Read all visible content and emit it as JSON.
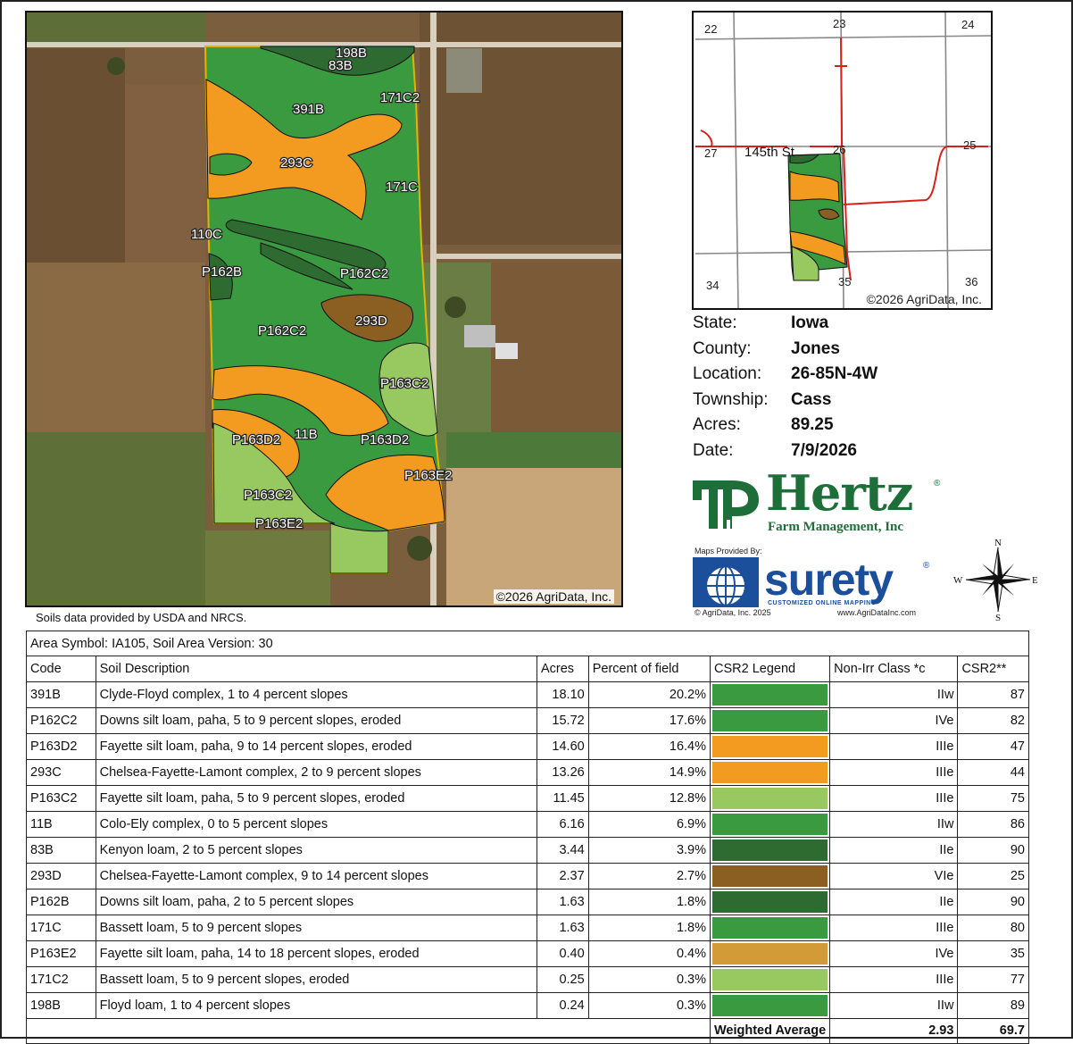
{
  "aerial_map": {
    "copyright": "©2026 AgriData, Inc.",
    "soil_labels": [
      "198B",
      "83B",
      "171C2",
      "391B",
      "293C",
      "171C",
      "110C",
      "P162B",
      "P162C2",
      "293D",
      "P162C2",
      "P163C2",
      "P163D2",
      "11B",
      "P163D2",
      "P163E2",
      "P163C2",
      "P163E2"
    ],
    "colors": {
      "dark_green": "#2e6b30",
      "green": "#3a9a40",
      "orange": "#f39a20",
      "light_green": "#98c860",
      "brown": "#8b5e22"
    }
  },
  "source_note": "Soils data provided by USDA and NRCS.",
  "locator_map": {
    "section_numbers": [
      "22",
      "23",
      "24",
      "27",
      "26",
      "25",
      "34",
      "35",
      "36"
    ],
    "road_label": "145th St",
    "copyright": "©2026 AgriData, Inc."
  },
  "info": {
    "state_label": "State:",
    "state": "Iowa",
    "county_label": "County:",
    "county": "Jones",
    "location_label": "Location:",
    "location": "26-85N-4W",
    "township_label": "Township:",
    "township": "Cass",
    "acres_label": "Acres:",
    "acres": "89.25",
    "date_label": "Date:",
    "date": "7/9/2026"
  },
  "hertz_logo": {
    "name": "Hertz",
    "registered": "®",
    "subtitle": "Farm Management, Inc",
    "color": "#1e6e3a"
  },
  "surety_logo": {
    "maps_by": "Maps Provided By:",
    "name": "surety",
    "registered": "®",
    "tagline": "CUSTOMIZED ONLINE MAPPING",
    "copyright": "© AgriData, Inc. 2025",
    "url": "www.AgriDataInc.com",
    "color": "#1b4e9b"
  },
  "compass": {
    "north": "N",
    "south": "S",
    "east": "E",
    "west": "W"
  },
  "table": {
    "area_line": "Area Symbol: IA105, Soil Area Version: 30",
    "headers": {
      "code": "Code",
      "description": "Soil Description",
      "acres": "Acres",
      "percent": "Percent of field",
      "legend": "CSR2 Legend",
      "class": "Non-Irr Class *c",
      "csr2": "CSR2**"
    },
    "rows": [
      {
        "code": "391B",
        "description": "Clyde-Floyd complex, 1 to 4 percent slopes",
        "acres": "18.10",
        "percent": "20.2%",
        "color": "#3a9a40",
        "class": "IIw",
        "csr2": "87"
      },
      {
        "code": "P162C2",
        "description": "Downs silt loam, paha, 5 to 9 percent slopes, eroded",
        "acres": "15.72",
        "percent": "17.6%",
        "color": "#3a9a40",
        "class": "IVe",
        "csr2": "82"
      },
      {
        "code": "P163D2",
        "description": "Fayette silt loam, paha, 9 to 14 percent slopes, eroded",
        "acres": "14.60",
        "percent": "16.4%",
        "color": "#f39a20",
        "class": "IIIe",
        "csr2": "47"
      },
      {
        "code": "293C",
        "description": "Chelsea-Fayette-Lamont complex, 2 to 9 percent slopes",
        "acres": "13.26",
        "percent": "14.9%",
        "color": "#f39a20",
        "class": "IIIe",
        "csr2": "44"
      },
      {
        "code": "P163C2",
        "description": "Fayette silt loam, paha, 5 to 9 percent slopes, eroded",
        "acres": "11.45",
        "percent": "12.8%",
        "color": "#98c860",
        "class": "IIIe",
        "csr2": "75"
      },
      {
        "code": "11B",
        "description": "Colo-Ely complex, 0 to 5 percent slopes",
        "acres": "6.16",
        "percent": "6.9%",
        "color": "#3a9a40",
        "class": "IIw",
        "csr2": "86"
      },
      {
        "code": "83B",
        "description": "Kenyon loam, 2 to 5 percent slopes",
        "acres": "3.44",
        "percent": "3.9%",
        "color": "#2e6b30",
        "class": "IIe",
        "csr2": "90"
      },
      {
        "code": "293D",
        "description": "Chelsea-Fayette-Lamont complex, 9 to 14 percent slopes",
        "acres": "2.37",
        "percent": "2.7%",
        "color": "#8b5e22",
        "class": "VIe",
        "csr2": "25"
      },
      {
        "code": "P162B",
        "description": "Downs silt loam, paha, 2 to 5 percent slopes",
        "acres": "1.63",
        "percent": "1.8%",
        "color": "#2e6b30",
        "class": "IIe",
        "csr2": "90"
      },
      {
        "code": "171C",
        "description": "Bassett loam, 5 to 9 percent slopes",
        "acres": "1.63",
        "percent": "1.8%",
        "color": "#3a9a40",
        "class": "IIIe",
        "csr2": "80"
      },
      {
        "code": "P163E2",
        "description": "Fayette silt loam, paha, 14 to 18 percent slopes, eroded",
        "acres": "0.40",
        "percent": "0.4%",
        "color": "#d39a38",
        "class": "IVe",
        "csr2": "35"
      },
      {
        "code": "171C2",
        "description": "Bassett loam, 5 to 9 percent slopes, eroded",
        "acres": "0.25",
        "percent": "0.3%",
        "color": "#98c860",
        "class": "IIIe",
        "csr2": "77"
      },
      {
        "code": "198B",
        "description": "Floyd loam, 1 to 4 percent slopes",
        "acres": "0.24",
        "percent": "0.3%",
        "color": "#3a9a40",
        "class": "IIw",
        "csr2": "89"
      }
    ],
    "weighted_average_label": "Weighted Average",
    "weighted_class": "2.93",
    "weighted_csr2": "69.7"
  }
}
